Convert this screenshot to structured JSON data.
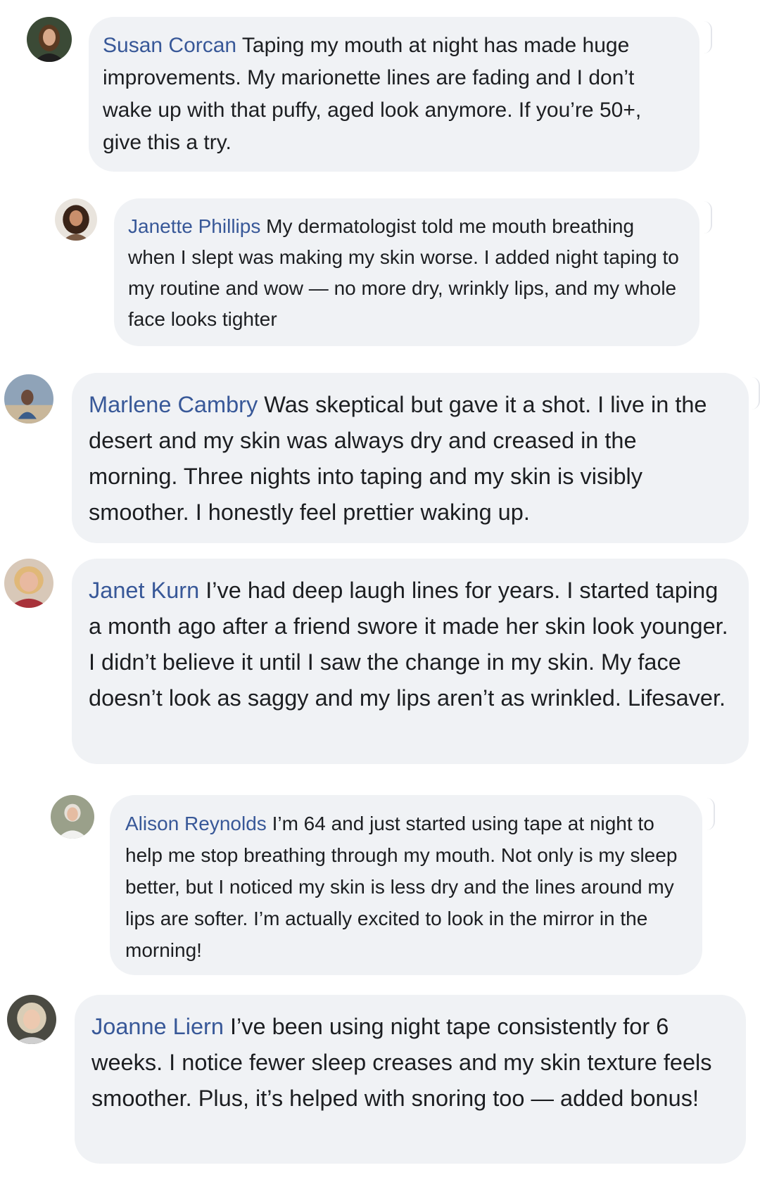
{
  "comments": [
    {
      "author": "Susan Corcan",
      "text": "Taping my mouth at night has made huge improvements. My marionette lines are fading and I don’t wake up with that puffy, aged look anymore. If you’re 50+, give this a try.",
      "avatar_icon": "woman-portrait-icon"
    },
    {
      "author": "Janette Phillips",
      "text": "My dermatologist told me mouth breathing when I slept was making my skin worse. I added night taping to my routine and wow — no more dry, wrinkly lips, and my whole face looks tighter",
      "avatar_icon": "woman-portrait-icon"
    },
    {
      "author": "Marlene Cambry",
      "text": "Was skeptical but gave it a shot. I live in the desert and my skin was always dry and creased in the morning. Three nights into taping and my skin is visibly smoother. I honestly feel prettier waking up.",
      "avatar_icon": "woman-portrait-icon"
    },
    {
      "author": "Janet Kurn",
      "text": "I’ve had deep laugh lines for years. I started taping a month ago after a friend swore it made her skin look younger. I didn’t believe it until I saw the change in my skin. My face doesn’t look as saggy and my lips aren’t as wrinkled. Lifesaver.",
      "avatar_icon": "woman-portrait-icon"
    },
    {
      "author": "Alison Reynolds",
      "text": "I’m 64 and just started using tape at night to help me stop breathing through my mouth. Not only is my sleep better, but I noticed my skin is less dry and the lines around my lips are softer. I’m actually excited to look in the mirror in the morning!",
      "avatar_icon": "woman-portrait-icon"
    },
    {
      "author": "Joanne Liern",
      "text": "I’ve been using night tape consistently for 6 weeks. I notice fewer sleep creases and my skin texture feels smoother. Plus, it’s helped with snoring too — added bonus!",
      "avatar_icon": "woman-portrait-icon"
    }
  ],
  "colors": {
    "author_link": "#385898",
    "bubble_bg": "#f0f2f5",
    "body_text": "#1c1e21"
  }
}
